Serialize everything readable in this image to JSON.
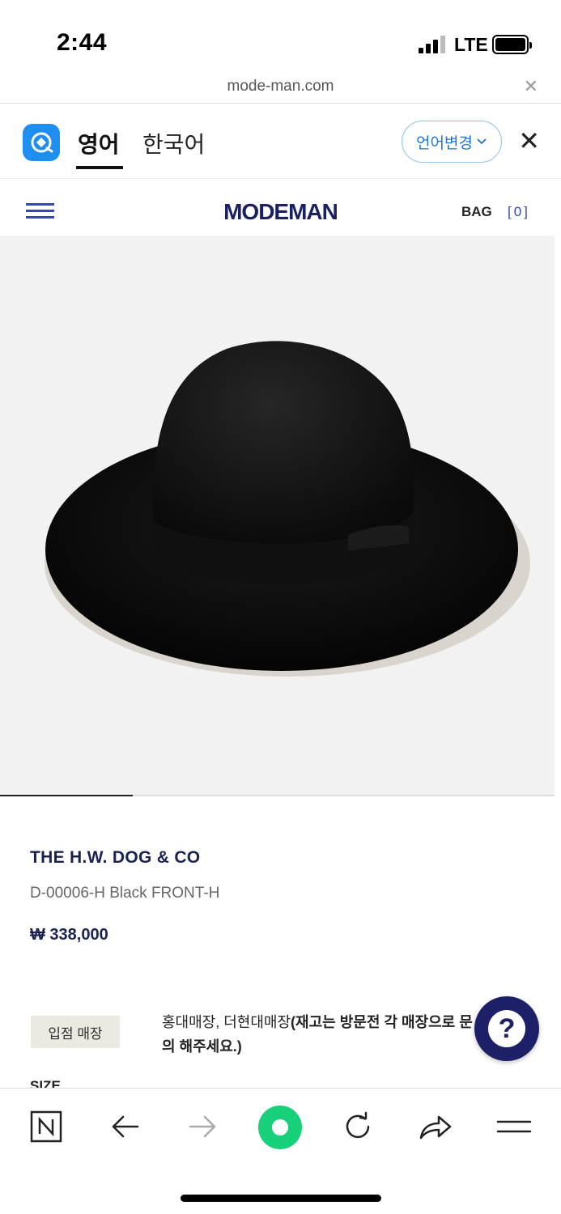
{
  "status_bar": {
    "time": "2:44",
    "network": "LTE"
  },
  "url_bar": {
    "domain": "mode-man.com"
  },
  "translate_bar": {
    "lang_active": "영어",
    "lang_other": "한국어",
    "change_button": "언어변경",
    "accent_color": "#1b74d6"
  },
  "site_header": {
    "logo": "MODEMAN",
    "bag_label": "BAG",
    "bag_count": "[0]",
    "brand_color": "#1a2060"
  },
  "gallery": {
    "current_slide": 1,
    "total_slides": 4,
    "alt": "black felt fedora hat"
  },
  "product": {
    "brand": "THE H.W. DOG & CO",
    "name": "D-00006-H Black FRONT-H",
    "price": "₩ 338,000",
    "store_label": "입점 매장",
    "store_text_plain": "홍대매장, 더현대매장",
    "store_text_bold": "(재고는 방문전 각 매장으로 문의 해주세요.)",
    "size_label": "SIZE"
  },
  "help_button": {
    "icon": "question-icon",
    "symbol": "?"
  },
  "toolbar": {
    "icons": [
      "naver-n-icon",
      "back-arrow-icon",
      "forward-arrow-icon",
      "green-dot-home-icon",
      "reload-icon",
      "share-icon",
      "menu-icon"
    ]
  }
}
